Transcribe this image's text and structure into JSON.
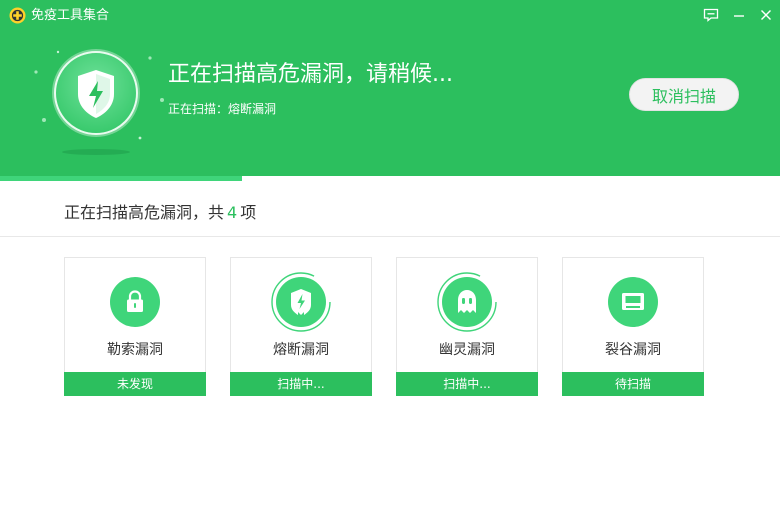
{
  "window": {
    "title": "免疫工具集合"
  },
  "header": {
    "scan_title": "正在扫描高危漏洞，请稍候...",
    "scan_subtitle": "正在扫描：熔断漏洞",
    "cancel_label": "取消扫描",
    "progress": 0.31
  },
  "summary": {
    "prefix": "正在扫描高危漏洞，共",
    "count": "4",
    "suffix": "项"
  },
  "cards": [
    {
      "name": "勒索漏洞",
      "status": "未发现",
      "icon": "lock-icon"
    },
    {
      "name": "熔断漏洞",
      "status": "扫描中...",
      "icon": "shield-bolt-icon"
    },
    {
      "name": "幽灵漏洞",
      "status": "扫描中...",
      "icon": "ghost-icon"
    },
    {
      "name": "裂谷漏洞",
      "status": "待扫描",
      "icon": "chip-icon"
    }
  ],
  "colors": {
    "brand_green": "#2cbf5e",
    "icon_green": "#3fd57a",
    "background": "#ffffff"
  }
}
